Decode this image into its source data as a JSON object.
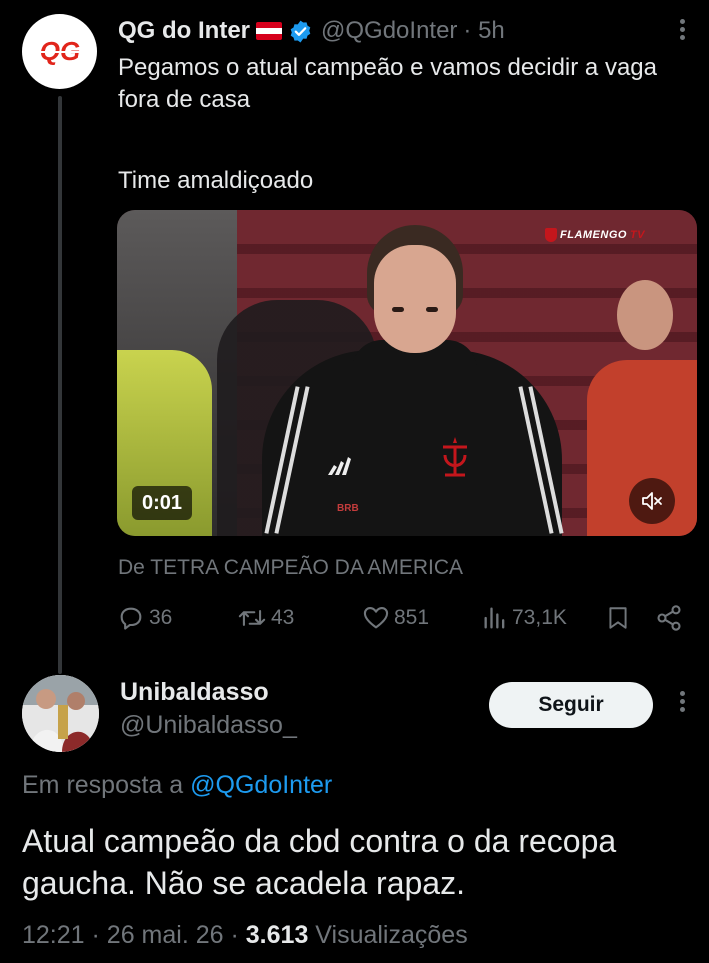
{
  "tweet": {
    "author_name": "QG do Inter",
    "author_handle": "@QGdoInter",
    "time_ago": "· 5h",
    "avatar_logo_text": "QG",
    "text_line1": "Pegamos o atual campeão e vamos decidir a vaga fora de casa",
    "text_line2": "Time amaldiçoado",
    "video": {
      "timestamp": "0:01",
      "watermark": "FLAMENGO",
      "watermark_suffix": "TV",
      "sponsor_text": "BRB"
    },
    "source_label": "De TETRA CAMPEÃO DA AMERICA",
    "actions": {
      "replies": "36",
      "reposts": "43",
      "likes": "851",
      "views": "73,1K"
    }
  },
  "reply": {
    "author_name": "Unibaldasso",
    "author_handle": "@Unibaldasso_",
    "follow_label": "Seguir",
    "reply_prefix": "Em resposta a",
    "reply_mention": "@QGdoInter",
    "text": "Atual campeão da cbd contra o da recopa gaucha. Não se acadela rapaz.",
    "time": "12:21",
    "date": "26 mai. 26",
    "views_count": "3.613",
    "views_label": "Visualizações"
  },
  "colors": {
    "background": "#000000",
    "text": "#e7e9ea",
    "secondary": "#71767b",
    "link": "#1d9bf0",
    "verified": "#1d9bf0",
    "brand_red": "#e1251b"
  },
  "icons": [
    "reply-icon",
    "repost-icon",
    "like-icon",
    "views-icon",
    "bookmark-icon",
    "share-icon",
    "mute-icon",
    "verified-badge-icon",
    "more-icon"
  ]
}
